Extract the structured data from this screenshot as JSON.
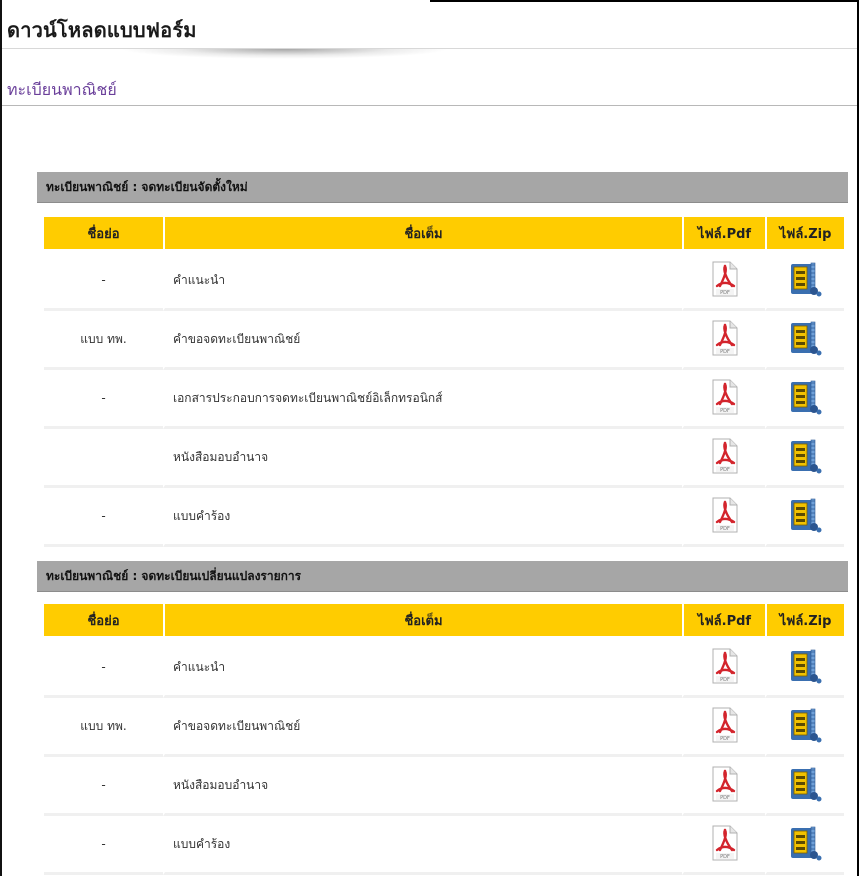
{
  "page": {
    "title": "ดาวน์โหลดแบบฟอร์ม",
    "section": "ทะเบียนพาณิชย์"
  },
  "colors": {
    "group_bar": "#a6a6a6",
    "header": "#ffcc00",
    "section_heading": "#6a3f9a",
    "pdf_red": "#d3242c",
    "zip_blue": "#3a6fb0",
    "zip_yellow": "#f2c200"
  },
  "icons": {
    "pdf": "pdf-file-icon",
    "zip": "zip-archive-icon"
  },
  "groups": [
    {
      "title": "ทะเบียนพาณิชย์ : จดทะเบียนจัดตั้งใหม่",
      "headers": {
        "short": "ชื่อย่อ",
        "full": "ชื่อเต็ม",
        "pdf": "ไฟล์.Pdf",
        "zip": "ไฟล์.Zip"
      },
      "rows": [
        {
          "short": "-",
          "full": "คำแนะนำ"
        },
        {
          "short": "แบบ ทพ.",
          "full": "คำขอจดทะเบียนพาณิชย์"
        },
        {
          "short": "-",
          "full": "เอกสารประกอบการจดทะเบียนพาณิชย์อิเล็กทรอนิกส์"
        },
        {
          "short": "",
          "full": "หนังสือมอบอำนาจ"
        },
        {
          "short": "-",
          "full": "แบบคำร้อง"
        }
      ]
    },
    {
      "title": "ทะเบียนพาณิชย์ : จดทะเบียนเปลี่ยนแปลงรายการ",
      "headers": {
        "short": "ชื่อย่อ",
        "full": "ชื่อเต็ม",
        "pdf": "ไฟล์.Pdf",
        "zip": "ไฟล์.Zip"
      },
      "rows": [
        {
          "short": "-",
          "full": "คำแนะนำ"
        },
        {
          "short": "แบบ ทพ.",
          "full": "คำขอจดทะเบียนพาณิชย์"
        },
        {
          "short": "-",
          "full": "หนังสือมอบอำนาจ"
        },
        {
          "short": "-",
          "full": "แบบคำร้อง"
        }
      ]
    }
  ]
}
